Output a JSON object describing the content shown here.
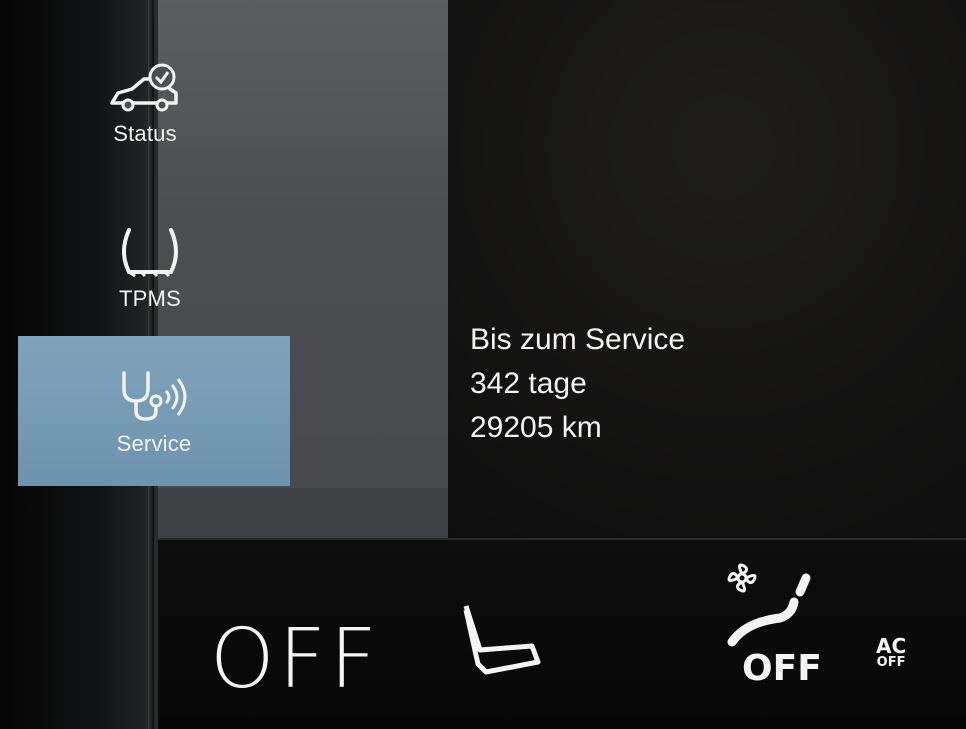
{
  "sidebar": {
    "items": [
      {
        "label": "Status",
        "icon": "car-check-icon"
      },
      {
        "label": "TPMS",
        "icon": "tire-pressure-icon"
      },
      {
        "label": "Service",
        "icon": "stethoscope-icon",
        "active": true
      }
    ]
  },
  "service_info": {
    "title": "Bis zum Service",
    "days": "342 tage",
    "distance": "29205 km"
  },
  "climate": {
    "off_label": "OFF",
    "fan_off_label": "OFF",
    "ac_top": "AC",
    "ac_bottom": "OFF"
  },
  "colors": {
    "sidebar_bg": "#4c4e52",
    "active_item": "#6d93ad",
    "text": "#f4f4f4"
  }
}
